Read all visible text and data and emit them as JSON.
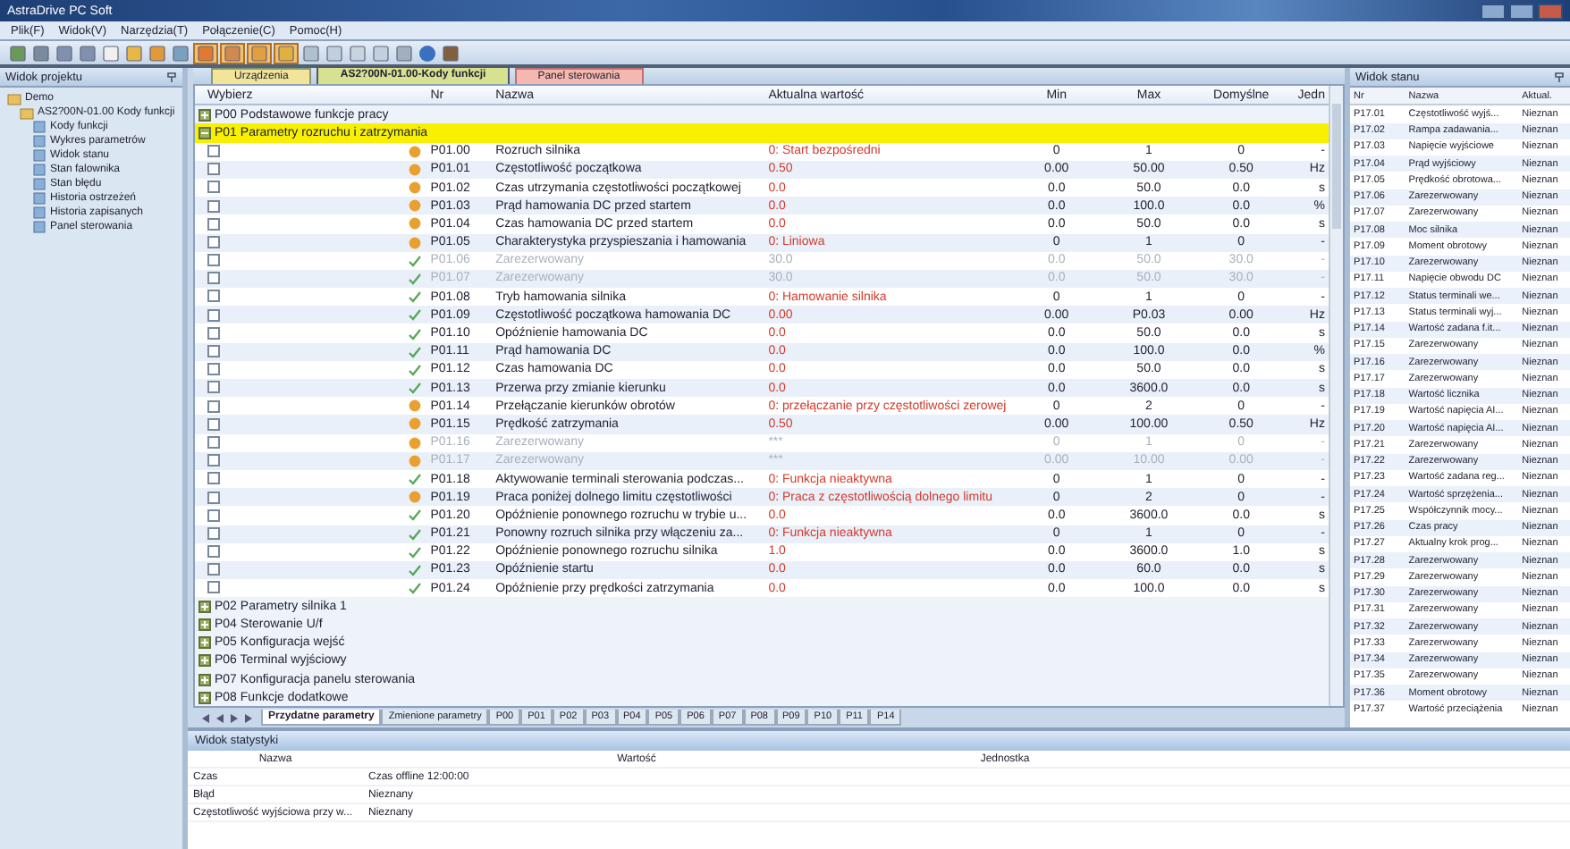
{
  "window": {
    "title": "AstraDrive PC Soft"
  },
  "menu": [
    "Plik(F)",
    "Widok(V)",
    "Narzędzia(T)",
    "Połączenie(C)",
    "Pomoc(H)"
  ],
  "project": {
    "title": "Widok projektu",
    "tree": [
      {
        "label": "Demo",
        "children": [
          {
            "label": "AS2?00N-01.00 Kody funkcji",
            "children": [
              {
                "label": "Kody funkcji"
              },
              {
                "label": "Wykres parametrów"
              },
              {
                "label": "Widok stanu"
              },
              {
                "label": "Stan falownika"
              },
              {
                "label": "Stan błędu"
              },
              {
                "label": "Historia ostrzeżeń"
              },
              {
                "label": "Historia zapisanych"
              },
              {
                "label": "Panel sterowania"
              }
            ]
          }
        ]
      }
    ]
  },
  "tabs": [
    {
      "label": "Urządzenia",
      "kind": "device",
      "selected": false
    },
    {
      "label": "AS2?00N-01.00-Kody funkcji",
      "kind": "codes",
      "selected": true
    },
    {
      "label": "Panel sterowania",
      "kind": "panel",
      "selected": false
    }
  ],
  "table": {
    "columns": [
      "Wybierz",
      "Nr",
      "Nazwa",
      "Aktualna wartość",
      "Min",
      "Max",
      "Domyślne",
      "Jedn"
    ],
    "groups": [
      {
        "label": "P00 Podstawowe funkcje pracy",
        "expanded": false,
        "selected": false
      },
      {
        "label": "P01 Parametry rozruchu i zatrzymania",
        "expanded": true,
        "selected": true,
        "params": [
          {
            "checked": false,
            "kind": "locked",
            "disabled": false,
            "code": "P01.00",
            "name": "Rozruch silnika",
            "value": "0: Start bezpośredni",
            "min": "0",
            "max": "1",
            "default": "0",
            "unit": "-"
          },
          {
            "checked": false,
            "kind": "locked",
            "disabled": false,
            "code": "P01.01",
            "name": "Częstotliwość początkowa",
            "value": "0.50",
            "min": "0.00",
            "max": "50.00",
            "default": "0.50",
            "unit": "Hz"
          },
          {
            "checked": false,
            "kind": "locked",
            "disabled": false,
            "code": "P01.02",
            "name": "Czas utrzymania częstotliwości początkowej",
            "value": "0.0",
            "min": "0.0",
            "max": "50.0",
            "default": "0.0",
            "unit": "s"
          },
          {
            "checked": false,
            "kind": "locked",
            "disabled": false,
            "code": "P01.03",
            "name": "Prąd hamowania DC przed startem",
            "value": "0.0",
            "min": "0.0",
            "max": "100.0",
            "default": "0.0",
            "unit": "%"
          },
          {
            "checked": false,
            "kind": "locked",
            "disabled": false,
            "code": "P01.04",
            "name": "Czas hamowania DC przed startem",
            "value": "0.0",
            "min": "0.0",
            "max": "50.0",
            "default": "0.0",
            "unit": "s"
          },
          {
            "checked": false,
            "kind": "locked",
            "disabled": false,
            "code": "P01.05",
            "name": "Charakterystyka przyspieszania i hamowania",
            "value": "0: Liniowa",
            "min": "0",
            "max": "1",
            "default": "0",
            "unit": "-"
          },
          {
            "checked": false,
            "kind": "changeable",
            "disabled": true,
            "code": "P01.06",
            "name": "Zarezerwowany",
            "value": "30.0",
            "min": "0.0",
            "max": "50.0",
            "default": "30.0",
            "unit": "-"
          },
          {
            "checked": false,
            "kind": "changeable",
            "disabled": true,
            "code": "P01.07",
            "name": "Zarezerwowany",
            "value": "30.0",
            "min": "0.0",
            "max": "50.0",
            "default": "30.0",
            "unit": "-"
          },
          {
            "checked": false,
            "kind": "changeable",
            "disabled": false,
            "code": "P01.08",
            "name": "Tryb hamowania silnika",
            "value": "0: Hamowanie silnika",
            "min": "0",
            "max": "1",
            "default": "0",
            "unit": "-"
          },
          {
            "checked": false,
            "kind": "changeable",
            "disabled": false,
            "code": "P01.09",
            "name": "Częstotliwość początkowa hamowania DC",
            "value": "0.00",
            "min": "0.00",
            "max": "P0.03",
            "default": "0.00",
            "unit": "Hz"
          },
          {
            "checked": false,
            "kind": "changeable",
            "disabled": false,
            "code": "P01.10",
            "name": "Opóźnienie hamowania DC",
            "value": "0.0",
            "min": "0.0",
            "max": "50.0",
            "default": "0.0",
            "unit": "s"
          },
          {
            "checked": false,
            "kind": "changeable",
            "disabled": false,
            "code": "P01.11",
            "name": "Prąd hamowania DC",
            "value": "0.0",
            "min": "0.0",
            "max": "100.0",
            "default": "0.0",
            "unit": "%"
          },
          {
            "checked": false,
            "kind": "changeable",
            "disabled": false,
            "code": "P01.12",
            "name": "Czas hamowania DC",
            "value": "0.0",
            "min": "0.0",
            "max": "50.0",
            "default": "0.0",
            "unit": "s"
          },
          {
            "checked": false,
            "kind": "changeable",
            "disabled": false,
            "code": "P01.13",
            "name": "Przerwa przy zmianie kierunku",
            "value": "0.0",
            "min": "0.0",
            "max": "3600.0",
            "default": "0.0",
            "unit": "s"
          },
          {
            "checked": false,
            "kind": "locked",
            "disabled": false,
            "code": "P01.14",
            "name": "Przełączanie kierunków obrotów",
            "value": "0: przełączanie przy częstotliwości zerowej",
            "min": "0",
            "max": "2",
            "default": "0",
            "unit": "-"
          },
          {
            "checked": false,
            "kind": "locked",
            "disabled": false,
            "code": "P01.15",
            "name": "Prędkość zatrzymania",
            "value": "0.50",
            "min": "0.00",
            "max": "100.00",
            "default": "0.50",
            "unit": "Hz"
          },
          {
            "checked": false,
            "kind": "locked",
            "disabled": true,
            "code": "P01.16",
            "name": "Zarezerwowany",
            "value": "***",
            "min": "0",
            "max": "1",
            "default": "0",
            "unit": "-"
          },
          {
            "checked": false,
            "kind": "locked",
            "disabled": true,
            "code": "P01.17",
            "name": "Zarezerwowany",
            "value": "***",
            "min": "0.00",
            "max": "10.00",
            "default": "0.00",
            "unit": "-"
          },
          {
            "checked": false,
            "kind": "changeable",
            "disabled": false,
            "code": "P01.18",
            "name": "Aktywowanie terminali sterowania podczas...",
            "value": "0: Funkcja nieaktywna",
            "min": "0",
            "max": "1",
            "default": "0",
            "unit": "-"
          },
          {
            "checked": false,
            "kind": "locked",
            "disabled": false,
            "code": "P01.19",
            "name": "Praca poniżej dolnego limitu częstotliwości",
            "value": "0: Praca z częstotliwością dolnego limitu",
            "min": "0",
            "max": "2",
            "default": "0",
            "unit": "-"
          },
          {
            "checked": false,
            "kind": "changeable",
            "disabled": false,
            "code": "P01.20",
            "name": "Opóźnienie ponownego rozruchu w trybie u...",
            "value": "0.0",
            "min": "0.0",
            "max": "3600.0",
            "default": "0.0",
            "unit": "s"
          },
          {
            "checked": false,
            "kind": "changeable",
            "disabled": false,
            "code": "P01.21",
            "name": "Ponowny rozruch silnika przy włączeniu za...",
            "value": "0: Funkcja nieaktywna",
            "min": "0",
            "max": "1",
            "default": "0",
            "unit": "-"
          },
          {
            "checked": false,
            "kind": "changeable",
            "disabled": false,
            "code": "P01.22",
            "name": "Opóźnienie ponownego rozruchu silnika",
            "value": "1.0",
            "min": "0.0",
            "max": "3600.0",
            "default": "1.0",
            "unit": "s"
          },
          {
            "checked": false,
            "kind": "changeable",
            "disabled": false,
            "code": "P01.23",
            "name": "Opóźnienie startu",
            "value": "0.0",
            "min": "0.0",
            "max": "60.0",
            "default": "0.0",
            "unit": "s"
          },
          {
            "checked": false,
            "kind": "changeable",
            "disabled": false,
            "code": "P01.24",
            "name": "Opóźnienie przy prędkości zatrzymania",
            "value": "0.0",
            "min": "0.0",
            "max": "100.0",
            "default": "0.0",
            "unit": "s"
          }
        ]
      },
      {
        "label": "P02 Parametry silnika 1",
        "expanded": false,
        "selected": false
      },
      {
        "label": "P04 Sterowanie U/f",
        "expanded": false,
        "selected": false
      },
      {
        "label": "P05 Konfiguracja wejść",
        "expanded": false,
        "selected": false
      },
      {
        "label": "P06 Terminal wyjściowy",
        "expanded": false,
        "selected": false
      },
      {
        "label": "P07 Konfiguracja panelu sterowania",
        "expanded": false,
        "selected": false
      },
      {
        "label": "P08 Funkcje dodatkowe",
        "expanded": false,
        "selected": false
      }
    ]
  },
  "sheet_tabs": [
    {
      "label": "Przydatne parametry",
      "selected": true
    },
    {
      "label": "Zmienione parametry",
      "selected": false
    },
    {
      "label": "P00",
      "selected": false
    },
    {
      "label": "P01",
      "selected": false
    },
    {
      "label": "P02",
      "selected": false
    },
    {
      "label": "P03",
      "selected": false
    },
    {
      "label": "P04",
      "selected": false
    },
    {
      "label": "P05",
      "selected": false
    },
    {
      "label": "P06",
      "selected": false
    },
    {
      "label": "P07",
      "selected": false
    },
    {
      "label": "P08",
      "selected": false
    },
    {
      "label": "P09",
      "selected": false
    },
    {
      "label": "P10",
      "selected": false
    },
    {
      "label": "P11",
      "selected": false
    },
    {
      "label": "P14",
      "selected": false
    }
  ],
  "status": {
    "title": "Widok stanu",
    "columns": [
      "Nr",
      "Nazwa",
      "Aktual."
    ],
    "rows": [
      [
        "P17.01",
        "Częstotliwość wyjś...",
        "Nieznan"
      ],
      [
        "P17.02",
        "Rampa zadawania...",
        "Nieznan"
      ],
      [
        "P17.03",
        "Napięcie wyjściowe",
        "Nieznan"
      ],
      [
        "P17.04",
        "Prąd wyjściowy",
        "Nieznan"
      ],
      [
        "P17.05",
        "Prędkość obrotowa...",
        "Nieznan"
      ],
      [
        "P17.06",
        "Zarezerwowany",
        "Nieznan"
      ],
      [
        "P17.07",
        "Zarezerwowany",
        "Nieznan"
      ],
      [
        "P17.08",
        "Moc silnika",
        "Nieznan"
      ],
      [
        "P17.09",
        "Moment obrotowy",
        "Nieznan"
      ],
      [
        "P17.10",
        "Zarezerwowany",
        "Nieznan"
      ],
      [
        "P17.11",
        "Napięcie obwodu DC",
        "Nieznan"
      ],
      [
        "P17.12",
        "Status terminali we...",
        "Nieznan"
      ],
      [
        "P17.13",
        "Status terminali wyj...",
        "Nieznan"
      ],
      [
        "P17.14",
        "Wartość zadana f.it...",
        "Nieznan"
      ],
      [
        "P17.15",
        "Zarezerwowany",
        "Nieznan"
      ],
      [
        "P17.16",
        "Zarezerwowany",
        "Nieznan"
      ],
      [
        "P17.17",
        "Zarezerwowany",
        "Nieznan"
      ],
      [
        "P17.18",
        "Wartość licznika",
        "Nieznan"
      ],
      [
        "P17.19",
        "Wartość napięcia AI...",
        "Nieznan"
      ],
      [
        "P17.20",
        "Wartość napięcia AI...",
        "Nieznan"
      ],
      [
        "P17.21",
        "Zarezerwowany",
        "Nieznan"
      ],
      [
        "P17.22",
        "Zarezerwowany",
        "Nieznan"
      ],
      [
        "P17.23",
        "Wartość zadana reg...",
        "Nieznan"
      ],
      [
        "P17.24",
        "Wartość sprzężenia...",
        "Nieznan"
      ],
      [
        "P17.25",
        "Współczynnik mocy...",
        "Nieznan"
      ],
      [
        "P17.26",
        "Czas pracy",
        "Nieznan"
      ],
      [
        "P17.27",
        "Aktualny krok prog...",
        "Nieznan"
      ],
      [
        "P17.28",
        "Zarezerwowany",
        "Nieznan"
      ],
      [
        "P17.29",
        "Zarezerwowany",
        "Nieznan"
      ],
      [
        "P17.30",
        "Zarezerwowany",
        "Nieznan"
      ],
      [
        "P17.31",
        "Zarezerwowany",
        "Nieznan"
      ],
      [
        "P17.32",
        "Zarezerwowany",
        "Nieznan"
      ],
      [
        "P17.33",
        "Zarezerwowany",
        "Nieznan"
      ],
      [
        "P17.34",
        "Zarezerwowany",
        "Nieznan"
      ],
      [
        "P17.35",
        "Zarezerwowany",
        "Nieznan"
      ],
      [
        "P17.36",
        "Moment obrotowy",
        "Nieznan"
      ],
      [
        "P17.37",
        "Wartość przeciążenia",
        "Nieznan"
      ]
    ]
  },
  "stats": {
    "title": "Widok statystyki",
    "columns": [
      "Nazwa",
      "Wartość",
      "Jednostka"
    ],
    "rows": [
      [
        "Czas",
        "Czas offline 12:00:00",
        ""
      ],
      [
        "Błąd",
        "Nieznany",
        ""
      ],
      [
        "Częstotliwość wyjściowa przy w...",
        "Nieznany",
        ""
      ]
    ]
  }
}
